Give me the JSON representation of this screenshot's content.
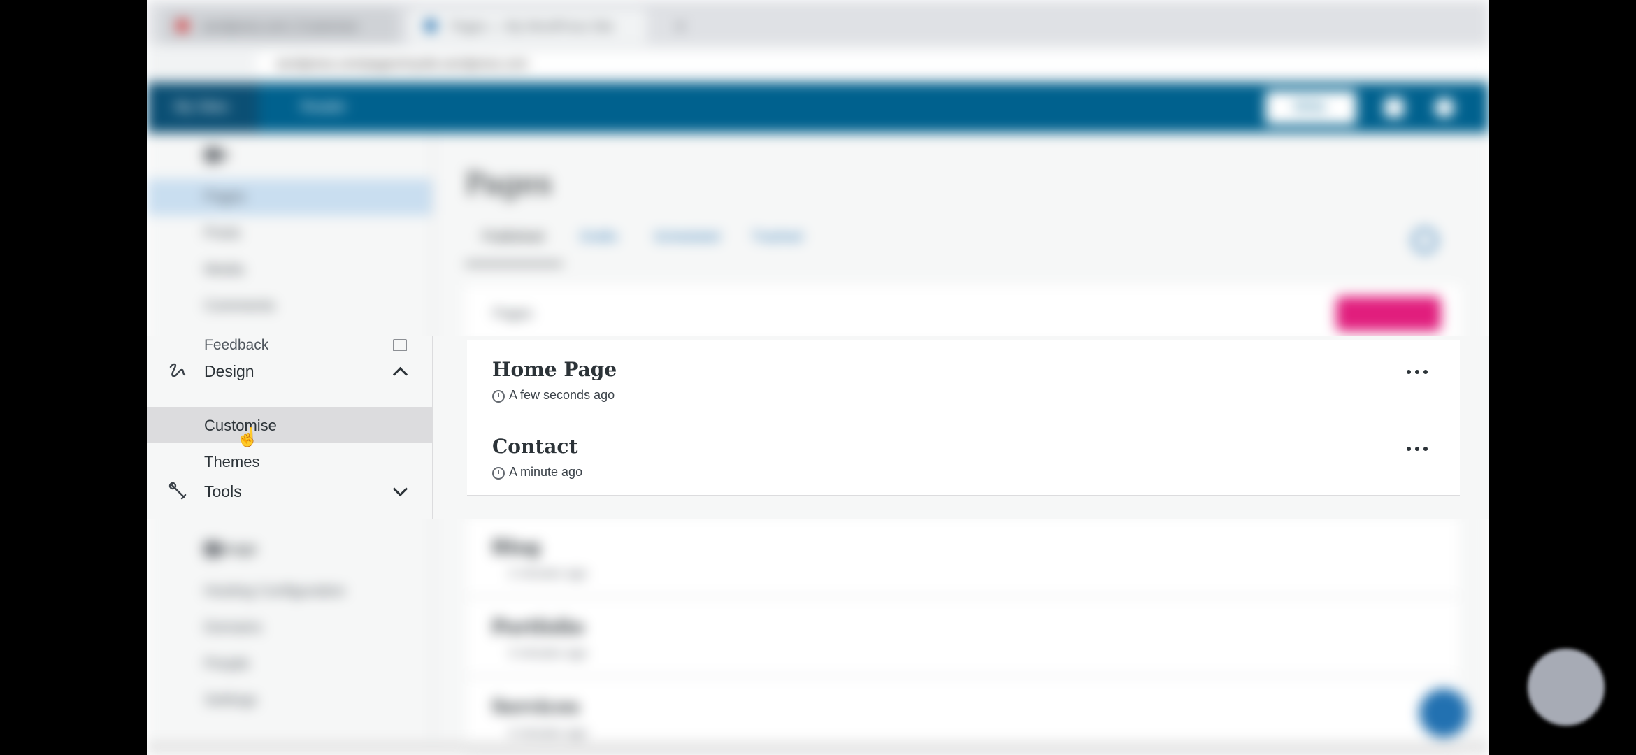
{
  "browser": {
    "tab_1_title": "wordpress.com | Customize",
    "tab_2_title": "Pages — My WordPress Site",
    "new_tab": "+",
    "url": "wordpress.com/pages/mysite.wordpress.com"
  },
  "wp_bar": {
    "my_sites": "My Sites",
    "reader": "Reader",
    "write": "Write"
  },
  "sidebar": {
    "site_menu": "Site",
    "items_top": [
      "Pages",
      "Posts",
      "Media",
      "Comments"
    ],
    "feedback": "Feedback",
    "design": {
      "label": "Design",
      "items": [
        "Customise",
        "Themes"
      ]
    },
    "tools": {
      "label": "Tools"
    },
    "manage": {
      "label": "Manage",
      "items": [
        "Hosting Configuration",
        "Domains",
        "People",
        "Settings"
      ]
    }
  },
  "main": {
    "heading": "Pages",
    "filters": [
      "Published",
      "Drafts",
      "Scheduled",
      "Trashed"
    ],
    "add_bar_label": "Pages",
    "add_button": "Add new page",
    "pages": [
      {
        "title": "Home Page",
        "time": "A few seconds ago"
      },
      {
        "title": "Contact",
        "time": "A minute ago"
      },
      {
        "title": "Blog",
        "time": "2 minutes ago"
      },
      {
        "title": "Portfolio",
        "time": "3 minutes ago"
      },
      {
        "title": "Services",
        "time": "4 minutes ago"
      }
    ]
  },
  "icons": {
    "design": "design-squiggle-icon",
    "tools": "wrench-icon",
    "more": "ellipsis-icon",
    "clock": "clock-icon",
    "external": "external-link-icon"
  },
  "colors": {
    "wp_blue": "#00618e",
    "accent_pink": "#e11e7d",
    "selected_bg": "#dcdcde"
  }
}
